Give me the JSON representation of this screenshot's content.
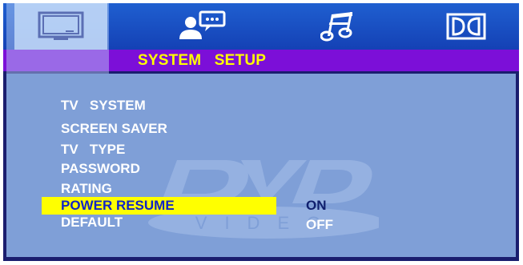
{
  "tabs": [
    {
      "name": "tv-icon",
      "active": true
    },
    {
      "name": "language-icon",
      "active": false
    },
    {
      "name": "audio-icon",
      "active": false
    },
    {
      "name": "dolby-icon",
      "active": false
    }
  ],
  "header": {
    "title": "SYSTEM   SETUP"
  },
  "menu": {
    "items": [
      {
        "label": "TV   SYSTEM"
      },
      {
        "label": "SCREEN SAVER"
      },
      {
        "label": "TV   TYPE"
      },
      {
        "label": "PASSWORD"
      },
      {
        "label": "RATING"
      },
      {
        "label": "POWER RESUME",
        "selected": true
      },
      {
        "label": "DEFAULT"
      }
    ],
    "options": [
      {
        "label": "ON",
        "color": "#10206e"
      },
      {
        "label": "OFF",
        "color": "#ffffff"
      }
    ]
  },
  "watermark": {
    "logo_text": "DVD",
    "sub_text": "VIDEO"
  },
  "colors": {
    "topbar": "#1f5fd0",
    "subbar": "#7c0fd8",
    "panel": "#7f9fd7",
    "highlight": "#ffff00",
    "title": "#ffff00"
  }
}
